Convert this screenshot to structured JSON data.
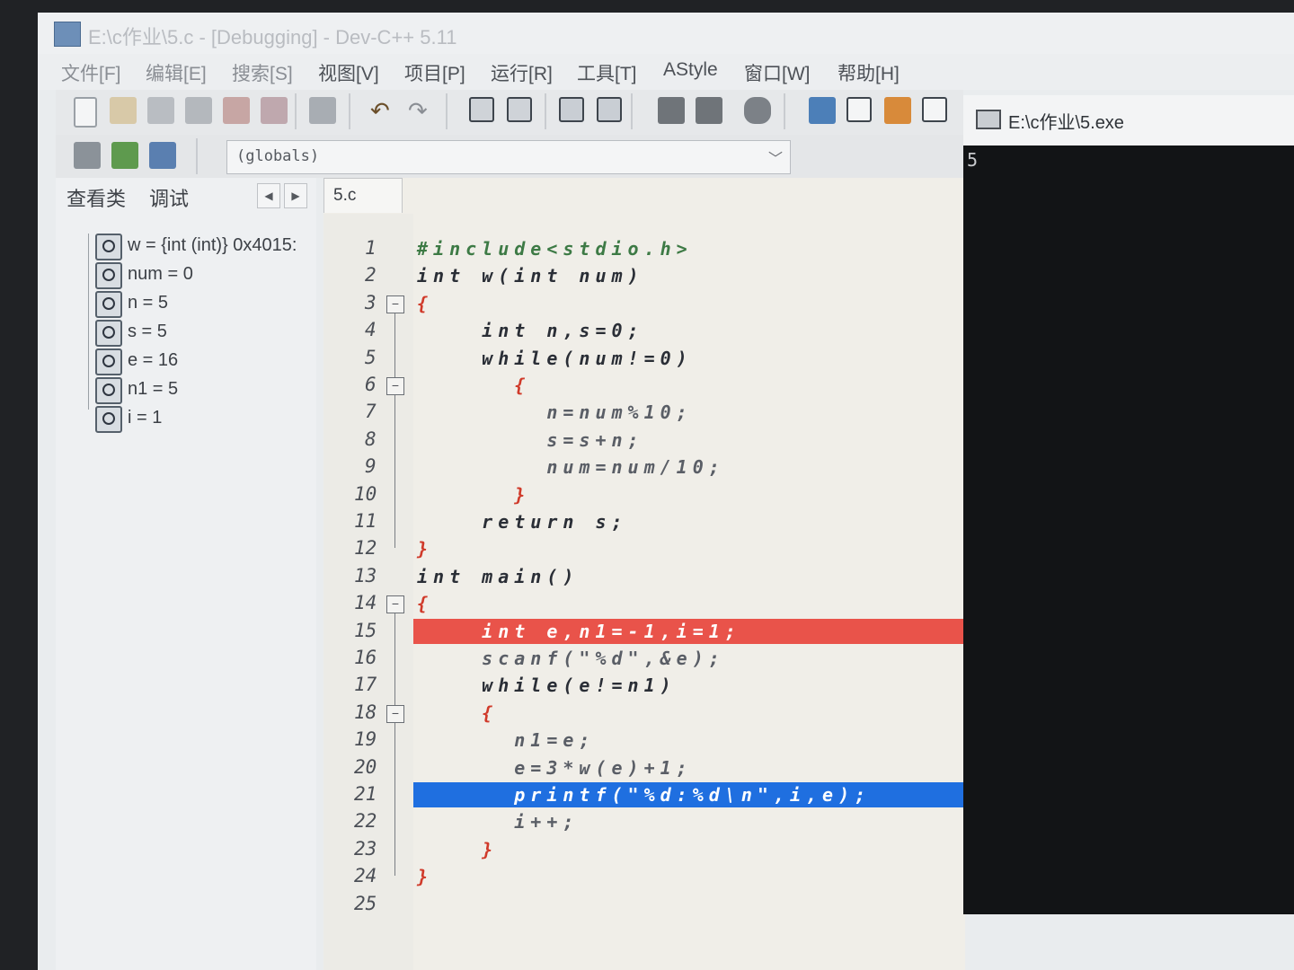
{
  "window": {
    "title": "E:\\c作业\\5.c - [Debugging] - Dev-C++ 5.11"
  },
  "menu": [
    "文件[F]",
    "编辑[E]",
    "搜索[S]",
    "视图[V]",
    "项目[P]",
    "运行[R]",
    "工具[T]",
    "AStyle",
    "窗口[W]",
    "帮助[H]"
  ],
  "scope_selector": {
    "value": "(globals)"
  },
  "left_panel": {
    "tabs": [
      "查看类",
      "调试"
    ],
    "watches": [
      "w = {int (int)} 0x4015:",
      "num = 0",
      "n = 5",
      "s = 5",
      "e = 16",
      "n1 = 5",
      "i = 1"
    ]
  },
  "editor": {
    "file_tab": "5.c",
    "lines": [
      {
        "n": "1",
        "text": "#include<stdio.h>",
        "color": "#3d7a45"
      },
      {
        "n": "2",
        "text": "int w(int num)",
        "color": "#2a2e36"
      },
      {
        "n": "3",
        "text": "{",
        "color": "#d03a2a"
      },
      {
        "n": "4",
        "text": "    int n,s=0;",
        "color": "#2a2e36"
      },
      {
        "n": "5",
        "text": "    while(num!=0)",
        "color": "#2a2e36"
      },
      {
        "n": "6",
        "text": "      {",
        "color": "#d03a2a"
      },
      {
        "n": "7",
        "text": "        n=num%10;",
        "color": "#5a5e66"
      },
      {
        "n": "8",
        "text": "        s=s+n;",
        "color": "#5a5e66"
      },
      {
        "n": "9",
        "text": "        num=num/10;",
        "color": "#5a5e66"
      },
      {
        "n": "10",
        "text": "      }",
        "color": "#d03a2a"
      },
      {
        "n": "11",
        "text": "    return s;",
        "color": "#2a2e36"
      },
      {
        "n": "12",
        "text": "}",
        "color": "#d03a2a"
      },
      {
        "n": "13",
        "text": "int main()",
        "color": "#2a2e36"
      },
      {
        "n": "14",
        "text": "{",
        "color": "#d03a2a"
      },
      {
        "n": "15",
        "text": "    int e,n1=-1,i=1;",
        "color": "#ffffff"
      },
      {
        "n": "16",
        "text": "    scanf(\"%d\",&e);",
        "color": "#5a5e66"
      },
      {
        "n": "17",
        "text": "    while(e!=n1)",
        "color": "#2a2e36"
      },
      {
        "n": "18",
        "text": "    {",
        "color": "#d03a2a"
      },
      {
        "n": "19",
        "text": "      n1=e;",
        "color": "#5a5e66"
      },
      {
        "n": "20",
        "text": "      e=3*w(e)+1;",
        "color": "#5a5e66"
      },
      {
        "n": "21",
        "text": "      printf(\"%d:%d\\n\",i,e);",
        "color": "#ffffff"
      },
      {
        "n": "22",
        "text": "      i++;",
        "color": "#5a5e66"
      },
      {
        "n": "23",
        "text": "    }",
        "color": "#d03a2a"
      },
      {
        "n": "24",
        "text": "}",
        "color": "#d03a2a"
      },
      {
        "n": "25",
        "text": "",
        "color": "#5a5e66"
      }
    ],
    "breakpoint_line": "15",
    "current_line": "21"
  },
  "console": {
    "title": "E:\\c作业\\5.exe",
    "output": "5"
  }
}
